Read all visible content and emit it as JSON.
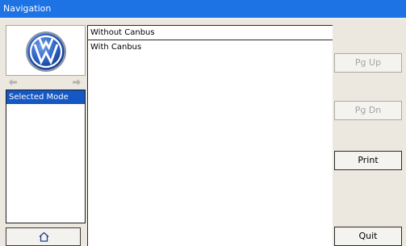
{
  "window": {
    "title": "Navigation"
  },
  "sidebar": {
    "logo": "volkswagen-logo",
    "modes": [
      "Selected Mode"
    ],
    "home_icon": "home-icon"
  },
  "main": {
    "items": [
      "Without Canbus",
      "With Canbus"
    ]
  },
  "buttons": {
    "page_up": "Pg Up",
    "page_down": "Pg Dn",
    "print": "Print",
    "quit": "Quit"
  },
  "colors": {
    "titlebar": "#1d72e4",
    "selection": "#1557c3",
    "background": "#ece8df"
  }
}
